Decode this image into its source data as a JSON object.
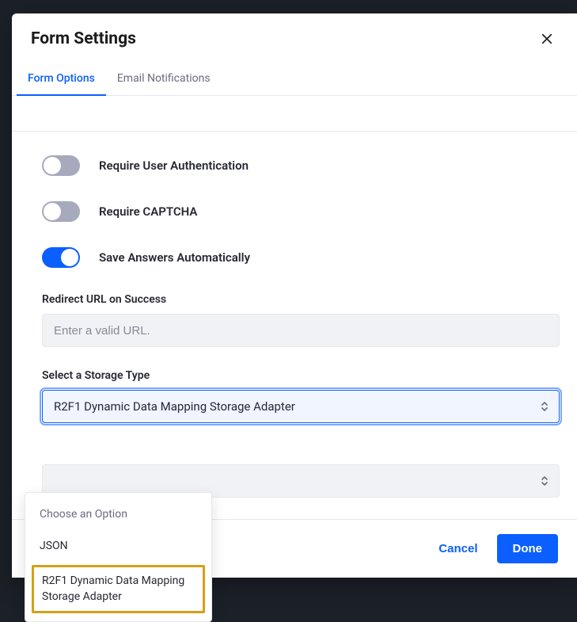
{
  "modal": {
    "title": "Form Settings",
    "tabs": [
      {
        "label": "Form Options",
        "active": true
      },
      {
        "label": "Email Notifications",
        "active": false
      }
    ]
  },
  "toggles": [
    {
      "label": "Require User Authentication",
      "on": false
    },
    {
      "label": "Require CAPTCHA",
      "on": false
    },
    {
      "label": "Save Answers Automatically",
      "on": true
    }
  ],
  "redirect": {
    "label": "Redirect URL on Success",
    "placeholder": "Enter a valid URL."
  },
  "storage": {
    "label": "Select a Storage Type",
    "value": "R2F1 Dynamic Data Mapping Storage Adapter",
    "options": {
      "placeholder": "Choose an Option",
      "opt1": "JSON",
      "opt2": "R2F1 Dynamic Data Mapping Storage Adapter"
    }
  },
  "footer": {
    "cancel": "Cancel",
    "done": "Done"
  }
}
